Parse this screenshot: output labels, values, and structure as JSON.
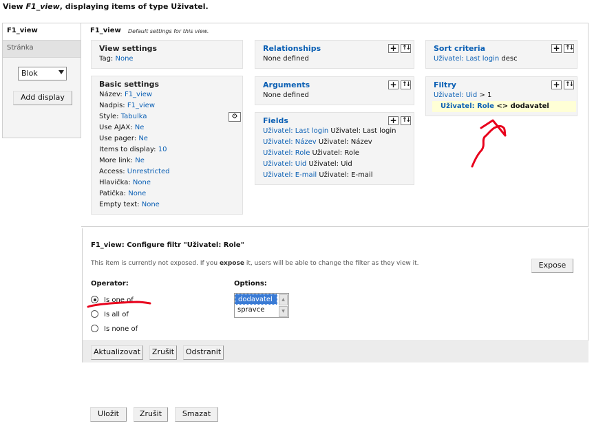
{
  "header": {
    "prefix": "View ",
    "view_name": "F1_view",
    "suffix": ", displaying items of type Uživatel."
  },
  "tabs": [
    {
      "label": "F1_view"
    },
    {
      "label": "Stránka"
    }
  ],
  "sidebar": {
    "display_select": "Blok",
    "add_display_label": "Add display"
  },
  "panel": {
    "name": "F1_view",
    "description": "Default settings for this view."
  },
  "view_settings": {
    "title": "View settings",
    "tag_label": "Tag:",
    "tag_value": "None"
  },
  "basic_settings": {
    "title": "Basic settings",
    "rows": [
      {
        "label": "Název:",
        "value": "F1_view"
      },
      {
        "label": "Nadpis:",
        "value": "F1_view"
      },
      {
        "label": "Style:",
        "value": "Tabulka"
      },
      {
        "label": "Use AJAX:",
        "value": "Ne"
      },
      {
        "label": "Use pager:",
        "value": "Ne"
      },
      {
        "label": "Items to display:",
        "value": "10"
      },
      {
        "label": "More link:",
        "value": "Ne"
      },
      {
        "label": "Access:",
        "value": "Unrestricted"
      },
      {
        "label": "Hlavička:",
        "value": "None"
      },
      {
        "label": "Patička:",
        "value": "None"
      },
      {
        "label": "Empty text:",
        "value": "None"
      }
    ]
  },
  "relationships": {
    "title": "Relationships",
    "text": "None defined"
  },
  "arguments": {
    "title": "Arguments",
    "text": "None defined"
  },
  "fields": {
    "title": "Fields",
    "rows": [
      {
        "link": "Uživatel: Last login",
        "text": "Uživatel: Last login"
      },
      {
        "link": "Uživatel: Název",
        "text": "Uživatel: Název"
      },
      {
        "link": "Uživatel: Role",
        "text": "Uživatel: Role"
      },
      {
        "link": "Uživatel: Uid",
        "text": "Uživatel: Uid"
      },
      {
        "link": "Uživatel: E-mail",
        "text": "Uživatel: E-mail"
      }
    ]
  },
  "sort": {
    "title": "Sort criteria",
    "link": "Uživatel: Last login",
    "suffix": "desc"
  },
  "filters": {
    "title": "Filtry",
    "row1_link": "Uživatel: Uid",
    "row1_text": "> 1",
    "row2_link": "Uživatel: Role",
    "row2_text": "<> dodavatel"
  },
  "config": {
    "title": "F1_view: Configure filtr \"Uživatel: Role\"",
    "note_1": "This item is currently not exposed. If you",
    "note_bold": "expose",
    "note_2": "it, users will be able to change the filter as they view it.",
    "expose_label": "Expose",
    "operator_label": "Operator:",
    "operators": [
      "Is one of",
      "Is all of",
      "Is none of"
    ],
    "options_label": "Options:",
    "options": [
      "dodavatel",
      "spravce"
    ],
    "buttons": [
      "Aktualizovat",
      "Zrušit",
      "Odstranit"
    ]
  },
  "footer_buttons": [
    "Uložit",
    "Zrušit",
    "Smazat"
  ],
  "colors": {
    "link": "#0a5fb4",
    "annotation": "#e8001c",
    "highlight": "#ffffd6"
  }
}
